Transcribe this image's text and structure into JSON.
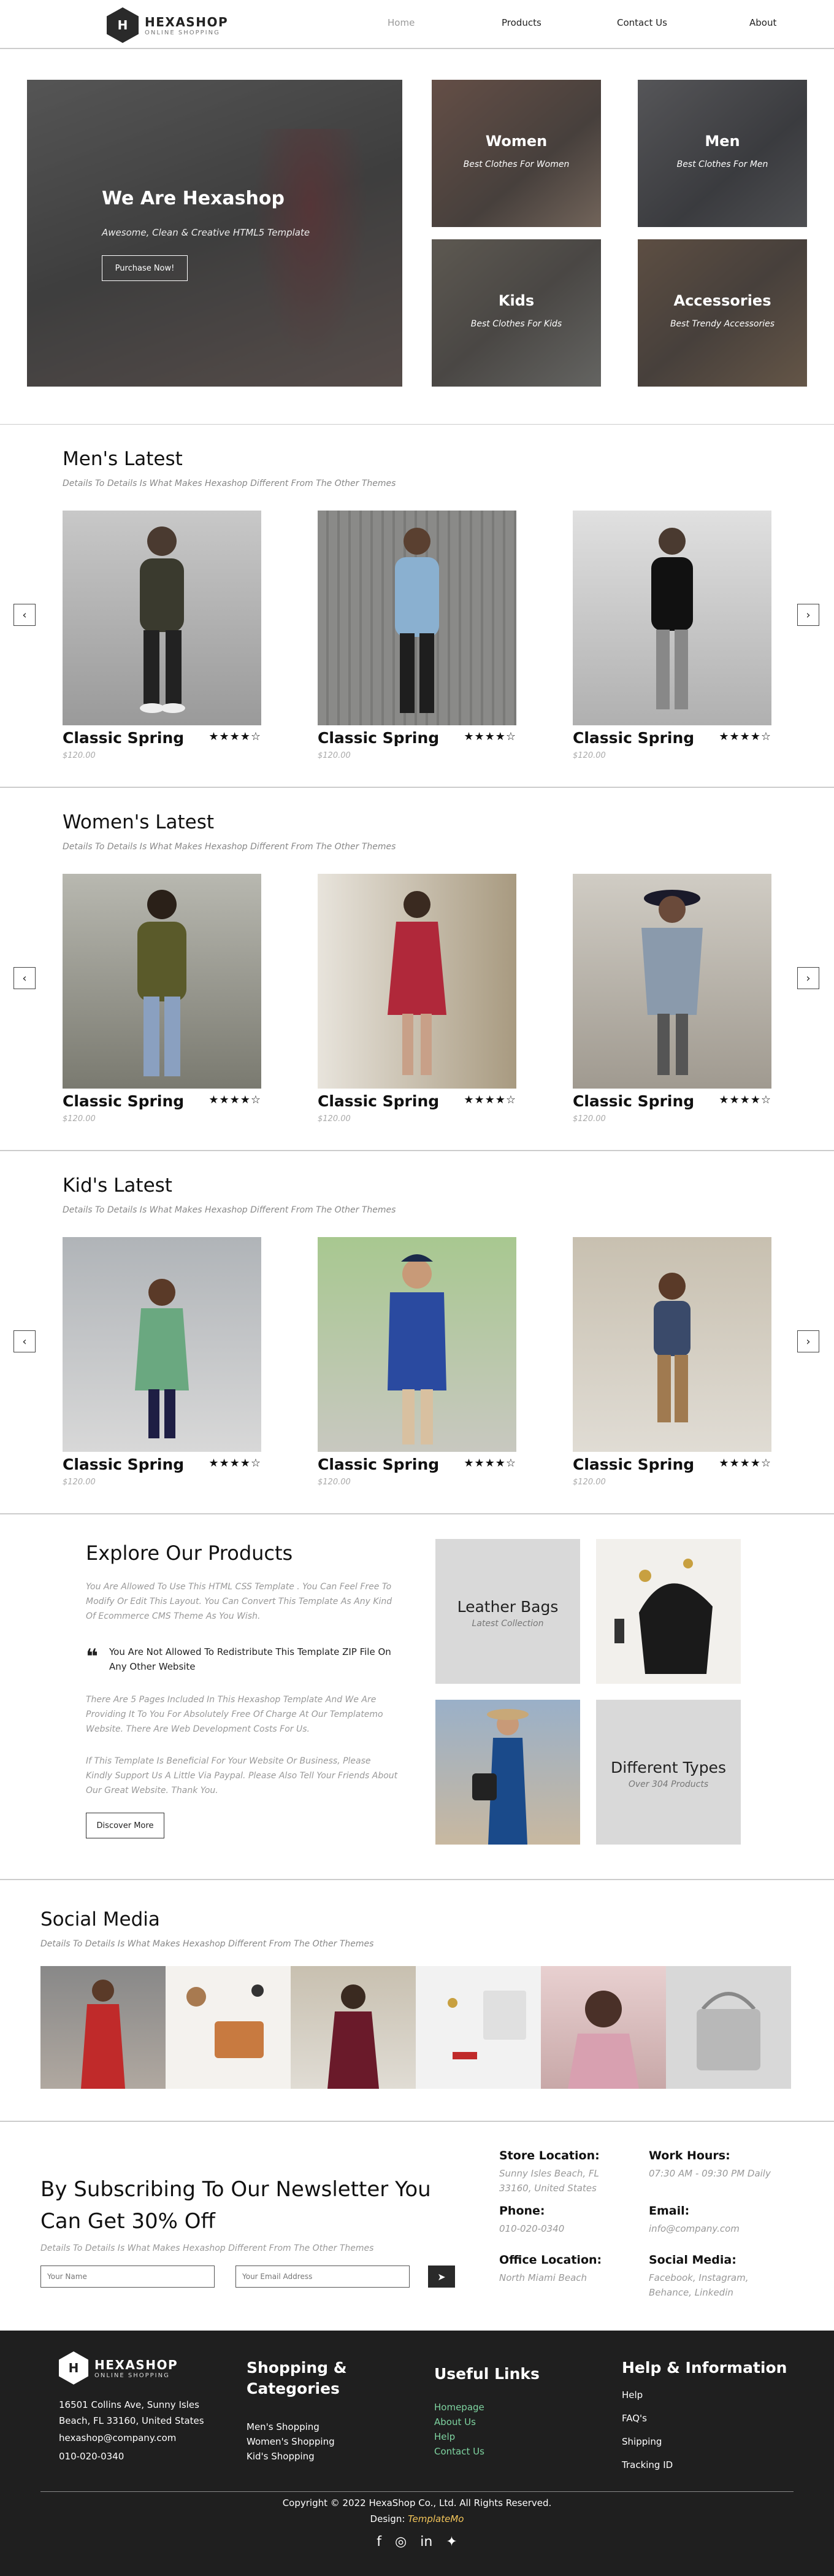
{
  "header": {
    "logo_letter": "H",
    "logo_name": "HEXASHOP",
    "logo_tagline": "ONLINE SHOPPING",
    "nav": [
      "Home",
      "Products",
      "Contact Us",
      "About"
    ]
  },
  "hero": {
    "title": "We Are Hexashop",
    "subtitle": "Awesome, Clean & Creative HTML5 Template",
    "button": "Purchase Now!",
    "tiles": [
      {
        "title": "Women",
        "subtitle": "Best Clothes For Women"
      },
      {
        "title": "Men",
        "subtitle": "Best Clothes For Men"
      },
      {
        "title": "Kids",
        "subtitle": "Best Clothes For Kids"
      },
      {
        "title": "Accessories",
        "subtitle": "Best Trendy Accessories"
      }
    ]
  },
  "sections": [
    {
      "title": "Men's Latest",
      "subtitle": "Details To Details Is What Makes Hexashop Different From The Other Themes",
      "products": [
        {
          "name": "Classic Spring",
          "price": "$120.00",
          "stars": "★★★★☆"
        },
        {
          "name": "Classic Spring",
          "price": "$120.00",
          "stars": "★★★★☆"
        },
        {
          "name": "Classic Spring",
          "price": "$120.00",
          "stars": "★★★★☆"
        }
      ]
    },
    {
      "title": "Women's Latest",
      "subtitle": "Details To Details Is What Makes Hexashop Different From The Other Themes",
      "products": [
        {
          "name": "Classic Spring",
          "price": "$120.00",
          "stars": "★★★★☆"
        },
        {
          "name": "Classic Spring",
          "price": "$120.00",
          "stars": "★★★★☆"
        },
        {
          "name": "Classic Spring",
          "price": "$120.00",
          "stars": "★★★★☆"
        }
      ]
    },
    {
      "title": "Kid's Latest",
      "subtitle": "Details To Details Is What Makes Hexashop Different From The Other Themes",
      "products": [
        {
          "name": "Classic Spring",
          "price": "$120.00",
          "stars": "★★★★☆"
        },
        {
          "name": "Classic Spring",
          "price": "$120.00",
          "stars": "★★★★☆"
        },
        {
          "name": "Classic Spring",
          "price": "$120.00",
          "stars": "★★★★☆"
        }
      ]
    }
  ],
  "explore": {
    "title": "Explore Our Products",
    "p1": "You Are Allowed To Use This HTML CSS Template . You Can Feel Free To Modify Or Edit This Layout. You Can Convert This Template As Any Kind Of Ecommerce CMS Theme As You Wish.",
    "quote": "You Are Not Allowed To Redistribute This Template ZIP File On Any Other Website",
    "p2": "There Are 5 Pages Included In This Hexashop Template And We Are Providing It To You For Absolutely Free Of Charge At Our Templatemo Website. There Are Web Development Costs For Us.",
    "p3": "If This Template Is Beneficial For Your Website Or Business, Please Kindly Support Us A Little Via Paypal. Please Also Tell Your Friends About Our Great Website. Thank You.",
    "button": "Discover More",
    "tile1_title": "Leather Bags",
    "tile1_sub": "Latest Collection",
    "tile2_title": "Different Types",
    "tile2_sub": "Over 304 Products"
  },
  "social": {
    "title": "Social Media",
    "subtitle": "Details To Details Is What Makes Hexashop Different From The Other Themes"
  },
  "newsletter": {
    "title": "By Subscribing To Our Newsletter You Can Get 30% Off",
    "subtitle": "Details To Details Is What Makes Hexashop Different From The Other Themes",
    "name_placeholder": "Your Name",
    "email_placeholder": "Your Email Address",
    "store_label": "Store Location:",
    "store_value": "Sunny Isles Beach, FL 33160, United States",
    "phone_label": "Phone:",
    "phone_value": "010-020-0340",
    "office_label": "Office Location:",
    "office_value": "North Miami Beach",
    "hours_label": "Work Hours:",
    "hours_value": "07:30 AM - 09:30 PM Daily",
    "email_label": "Email:",
    "email_value": "info@company.com",
    "social_label": "Social Media:",
    "social_value": "Facebook, Instagram, Behance, Linkedin"
  },
  "footer": {
    "logo_letter": "H",
    "logo_name": "HEXASHOP",
    "logo_tagline": "ONLINE SHOPPING",
    "address": "16501 Collins Ave, Sunny Isles Beach, FL 33160, United States",
    "email": "hexashop@company.com",
    "phone": "010-020-0340",
    "col2_title": "Shopping & Categories",
    "col2_links": [
      "Men's Shopping",
      "Women's Shopping",
      "Kid's Shopping"
    ],
    "col3_title": "Useful Links",
    "col3_links": [
      "Homepage",
      "About Us",
      "Help",
      "Contact Us"
    ],
    "col4_title": "Help & Information",
    "col4_links": [
      "Help",
      "FAQ's",
      "Shipping",
      "Tracking ID"
    ],
    "copyright": "Copyright © 2022 HexaShop Co., Ltd. All Rights Reserved.",
    "design_prefix": "Design: ",
    "design_brand": "TemplateMo",
    "icons": [
      "facebook-icon",
      "instagram-icon",
      "linkedin-icon",
      "twitter-icon"
    ]
  }
}
